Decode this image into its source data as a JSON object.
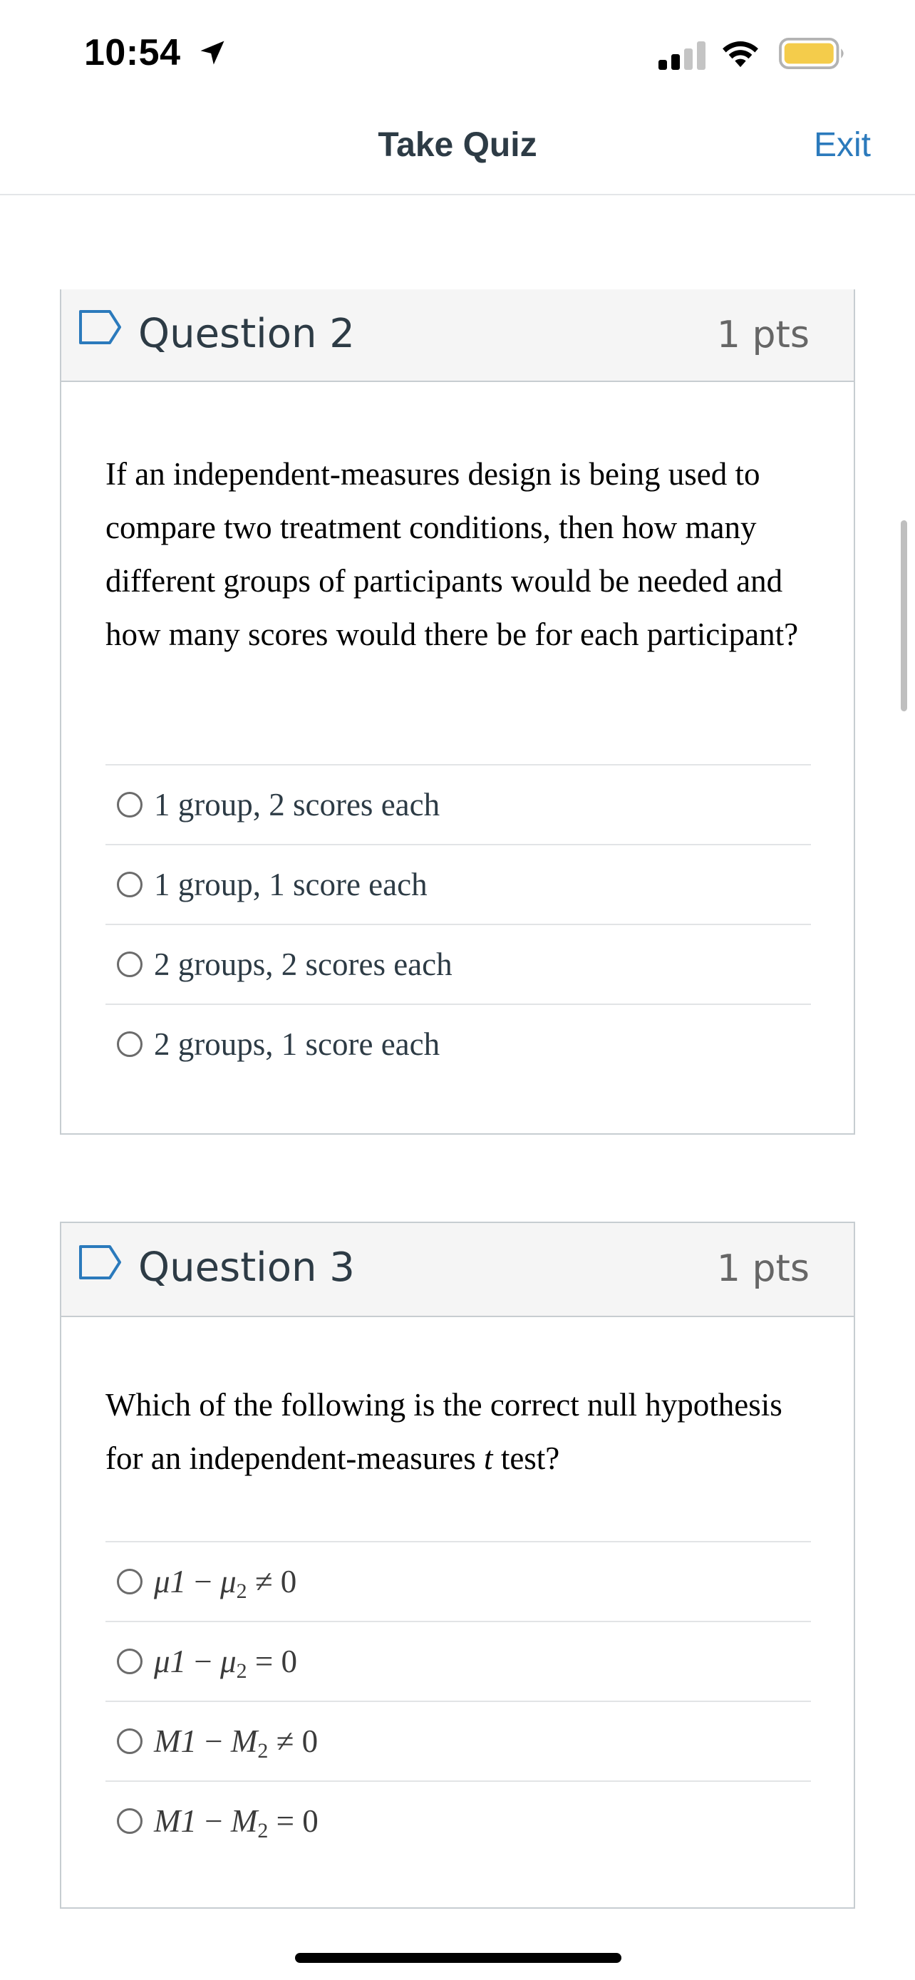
{
  "status_bar": {
    "time": "10:54",
    "location_icon": "location-arrow-icon",
    "signal_icon": "cellular-signal-icon",
    "wifi_icon": "wifi-icon",
    "battery_icon": "battery-icon",
    "battery_color": "#f4cc4b"
  },
  "nav": {
    "title": "Take Quiz",
    "exit_label": "Exit",
    "accent_color": "#2b7abc"
  },
  "questions": [
    {
      "title": "Question 2",
      "points": "1 pts",
      "flag_icon": "flag-bookmark-icon",
      "text": "If an independent-measures design is being used to compare two treatment conditions, then how many different groups of participants would be needed and how many scores would there be for each participant?",
      "answers": [
        "1 group, 2 scores each",
        "1 group, 1 score each",
        "2 groups, 2 scores each",
        "2 groups, 1 score each"
      ]
    },
    {
      "title": "Question 3",
      "points": "1 pts",
      "flag_icon": "flag-bookmark-icon",
      "text_before": "Which of the following is the correct null hypothesis for an independent-measures ",
      "text_italic": "t",
      "text_after": " test?",
      "answers": [
        {
          "a": "μ1",
          "op": "−",
          "b": "μ",
          "b_sub": "2",
          "rel": "≠",
          "rhs": "0"
        },
        {
          "a": "μ1",
          "op": "−",
          "b": "μ",
          "b_sub": "2",
          "rel": "=",
          "rhs": "0"
        },
        {
          "a": "M1",
          "op": "−",
          "b": "M",
          "b_sub": "2",
          "rel": "≠",
          "rhs": "0"
        },
        {
          "a": "M1",
          "op": "−",
          "b": "M",
          "b_sub": "2",
          "rel": "=",
          "rhs": "0"
        }
      ]
    }
  ]
}
